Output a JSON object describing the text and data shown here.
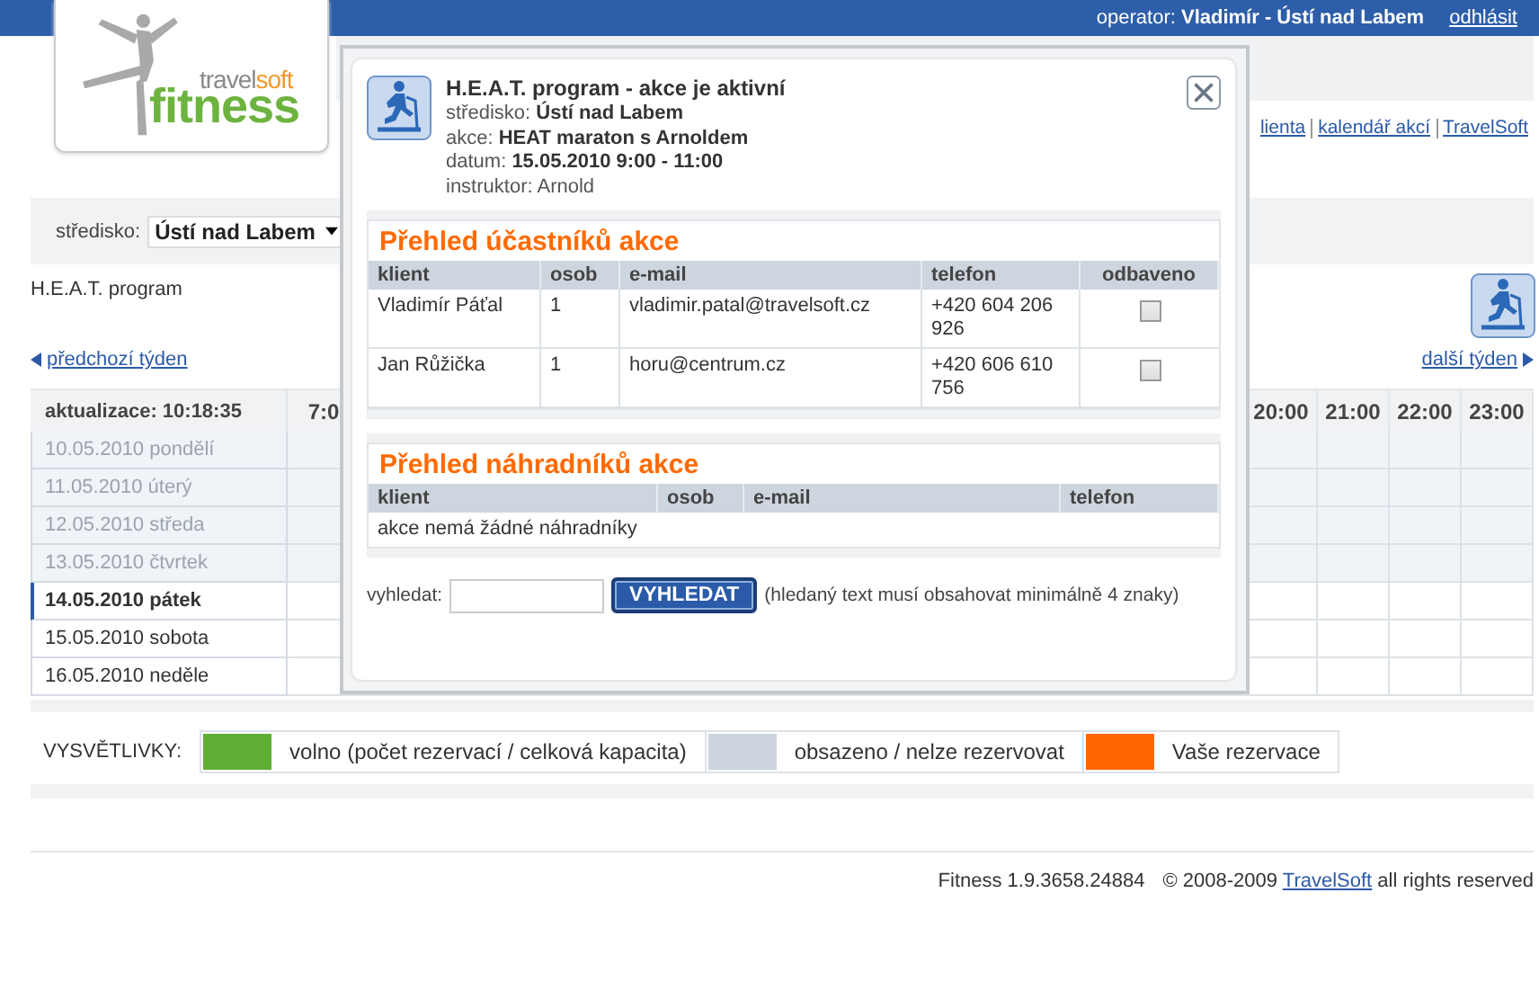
{
  "header": {
    "operator": "operator: **Vladimír - Ústí nad Labem**",
    "logout": "odhlásit"
  },
  "logo": {
    "word_1": "travel",
    "word_2": "soft",
    "word_main": "fitness"
  },
  "links": [
    "lienta",
    "kalendář akcí",
    "TravelSoft"
  ],
  "filter": {
    "label": "středisko:",
    "value": "Ústí nad Labem"
  },
  "program_title": "H.E.A.T. program",
  "nav": {
    "prev": "předchozí týden",
    "next": "další týden"
  },
  "schedule": {
    "update_label": "aktualizace: 10:18:35",
    "columns": [
      "7:0",
      "20:00",
      "21:00",
      "22:00",
      "23:00"
    ],
    "days": [
      {
        "label": "10.05.2010 pondělí",
        "past": true,
        "selected": false
      },
      {
        "label": "11.05.2010 úterý",
        "past": true,
        "selected": false
      },
      {
        "label": "12.05.2010 středa",
        "past": true,
        "selected": false
      },
      {
        "label": "13.05.2010 čtvrtek",
        "past": true,
        "selected": false
      },
      {
        "label": "14.05.2010 pátek",
        "past": false,
        "selected": true
      },
      {
        "label": "15.05.2010 sobota",
        "past": false,
        "selected": false
      },
      {
        "label": "16.05.2010 neděle",
        "past": false,
        "selected": false
      }
    ]
  },
  "legend": {
    "label": "VYSVĚTLIVKY:",
    "items": [
      {
        "label": "volno (počet rezervací / celková kapacita)",
        "color": "#5fae35"
      },
      {
        "label": "obsazeno / nelze rezervovat",
        "color": "#ccd4de"
      },
      {
        "label": "Vaše rezervace",
        "color": "#ff6600"
      }
    ]
  },
  "footer": {
    "version": "Fitness 1.9.3658.24884",
    "copyright": "© 2008-2009",
    "company": "TravelSoft",
    "rights": "all rights reserved"
  },
  "modal": {
    "title": "H.E.A.T. program - akce je aktivní",
    "info": [
      "středisko: **Ústí nad Labem**",
      "akce: **HEAT maraton s Arnoldem**",
      "datum: **15.05.2010 9:00 - 11:00**",
      "instruktor: Arnold"
    ],
    "participants": {
      "heading": "Přehled účastníků akce",
      "columns": [
        "klient",
        "osob",
        "e-mail",
        "telefon",
        "odbaveno"
      ],
      "rows": [
        {
          "client": "Vladimír Páťal",
          "persons": "1",
          "email": "vladimir.patal@travelsoft.cz",
          "phone": "+420 604 206 926",
          "checked": false
        },
        {
          "client": "Jan Růžička",
          "persons": "1",
          "email": "horu@centrum.cz",
          "phone": "+420 606 610 756",
          "checked": false
        }
      ]
    },
    "substitutes": {
      "heading": "Přehled náhradníků akce",
      "columns": [
        "klient",
        "osob",
        "e-mail",
        "telefon"
      ],
      "empty": "akce nemá žádné náhradníky"
    },
    "search": {
      "label": "vyhledat:",
      "button": "VYHLEDAT",
      "hint": "(hledaný text musí obsahovat minimálně 4 znaky)"
    }
  }
}
